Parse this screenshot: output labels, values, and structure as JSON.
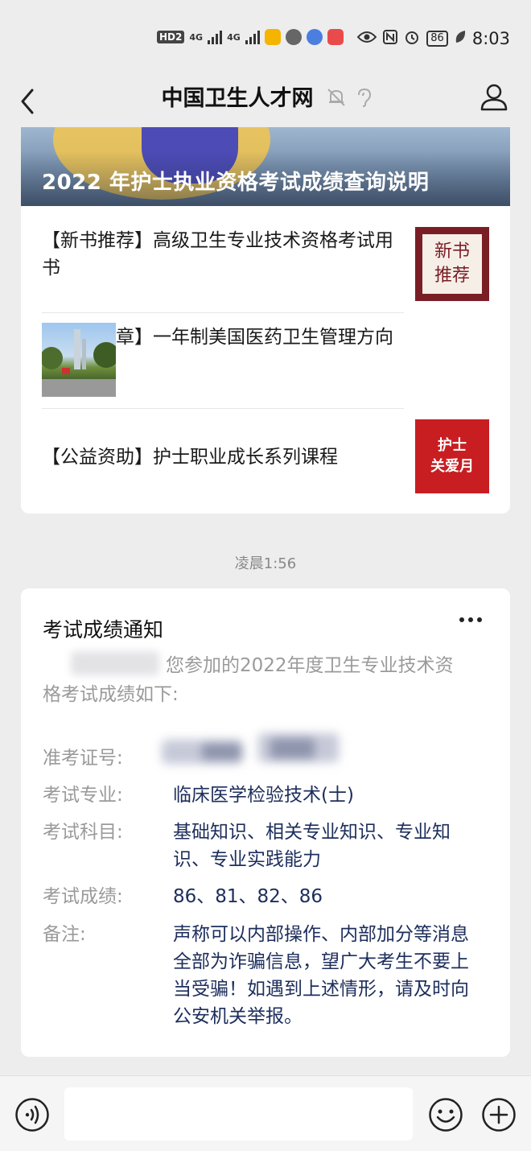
{
  "status_bar": {
    "hd_label": "HD",
    "hd_sub": "2",
    "net1": "4G",
    "net2": "4G",
    "battery": "86",
    "time": "8:03"
  },
  "nav": {
    "title": "中国卫生人才网"
  },
  "article_card": {
    "banner_title": "2022 年护士执业资格考试成绩查询说明",
    "items": [
      {
        "text": "【新书推荐】高级卫生专业技术资格考试用书",
        "thumb_lines": [
          "新书",
          "推荐"
        ]
      },
      {
        "text": "【招生简章】一年制美国医药卫生管理方向 MBA"
      },
      {
        "text": "【公益资助】护士职业成长系列课程",
        "thumb_lines": [
          "护士",
          "关爱月"
        ]
      }
    ]
  },
  "timestamp": "凌晨1:56",
  "notice": {
    "title": "考试成绩通知",
    "intro_line1": "您参加的2022年度卫生专业技术资",
    "intro_line2": "格考试成绩如下:",
    "rows": [
      {
        "label": "准考证号:",
        "value": ""
      },
      {
        "label": "考试专业:",
        "value": "临床医学检验技术(士)"
      },
      {
        "label": "考试科目:",
        "value": "基础知识、相关专业知识、专业知识、专业实践能力"
      },
      {
        "label": "考试成绩:",
        "value": "86、81、82、86"
      },
      {
        "label": "备注:",
        "value": "声称可以内部操作、内部加分等消息全部为诈骗信息，望广大考生不要上当受骗！如遇到上述情形，请及时向公安机关举报。"
      }
    ]
  },
  "input_bar": {
    "placeholder": ""
  },
  "colors": {
    "background": "#ededed",
    "card": "#ffffff",
    "value_text": "#1d2e5c",
    "label_text": "#9a9a9a"
  }
}
